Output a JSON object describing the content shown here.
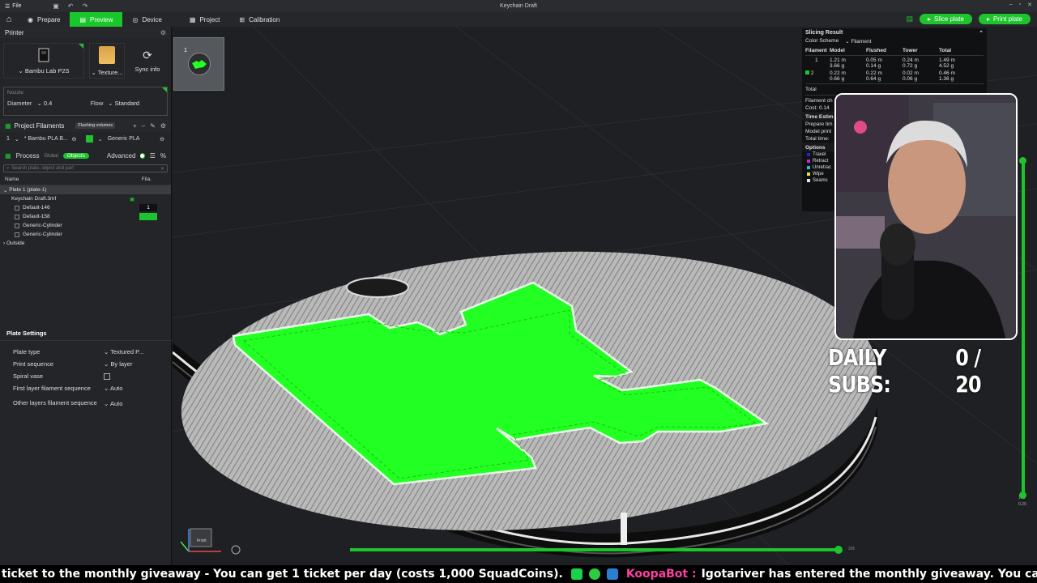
{
  "titlebar": {
    "file_label": "File",
    "doc_title": "Keychain Draft"
  },
  "nav": {
    "tabs": [
      {
        "label": "Prepare",
        "icon": "prepare-icon"
      },
      {
        "label": "Preview",
        "icon": "preview-icon",
        "active": true
      },
      {
        "label": "Device",
        "icon": "device-icon"
      },
      {
        "label": "Project",
        "icon": "project-icon"
      },
      {
        "label": "Calibration",
        "icon": "calibration-icon"
      }
    ],
    "slice_label": "Slice plate",
    "print_label": "Print plate"
  },
  "printer": {
    "section_title": "Printer",
    "printer_name": "Bambu Lab P2S",
    "plate_label": "Texture...",
    "sync_label": "Sync info",
    "nozzle_label": "Nozzle",
    "diameter_label": "Diameter",
    "diameter_value": "0.4",
    "flow_label": "Flow",
    "flow_value": "Standard"
  },
  "filaments": {
    "section_title": "Project Filaments",
    "flushing_label": "Flushing volumes",
    "row_index": "1",
    "row_name": "* Bambu PLA B...",
    "row_type": "Generic PLA"
  },
  "process": {
    "section_title": "Process",
    "global_label": "Global",
    "objects_label": "Objects",
    "advanced_label": "Advanced",
    "search_placeholder": "Search plate, object and part",
    "col_name": "Name",
    "col_fila": "Fila.",
    "tree": [
      {
        "label": "Plate 1 (plate-1)",
        "indent": 0,
        "selected": true
      },
      {
        "label": "Keychain Draft.3mf",
        "indent": 1,
        "fila": "check"
      },
      {
        "label": "Default-146",
        "indent": 2,
        "fila": "1"
      },
      {
        "label": "Default-158",
        "indent": 2,
        "fila": "swatch"
      },
      {
        "label": "Generic-Cylinder",
        "indent": 2
      },
      {
        "label": "Generic-Cylinder",
        "indent": 2
      },
      {
        "label": "Outside",
        "indent": 0
      }
    ]
  },
  "plate_settings": {
    "title": "Plate Settings",
    "rows": [
      {
        "label": "Plate type",
        "value": "Textured P..."
      },
      {
        "label": "Print sequence",
        "value": "By layer"
      },
      {
        "label": "Spiral vase",
        "value": ""
      },
      {
        "label": "First layer filament sequence",
        "value": "Auto"
      },
      {
        "label": "Other layers filament sequence",
        "value": "Auto"
      }
    ]
  },
  "plate_tab": {
    "number": "1"
  },
  "result": {
    "title": "Slicing Result",
    "color_scheme_label": "Color Scheme",
    "color_scheme_value": "Filament",
    "headers": [
      "Filament",
      "Model",
      "Flushed",
      "Tower",
      "Total"
    ],
    "rows": [
      {
        "id": "1",
        "model": "1.21 m",
        "model2": "3.66 g",
        "flushed": "0.05 m",
        "flushed2": "0.14 g",
        "tower": "0.24 m",
        "tower2": "0.72 g",
        "total": "1.49 m",
        "total2": "4.52 g"
      },
      {
        "id": "2",
        "model": "0.22 m",
        "model2": "0.66 g",
        "flushed": "0.22 m",
        "flushed2": "0.64 g",
        "tower": "0.02 m",
        "tower2": "0.06 g",
        "total": "0.46 m",
        "total2": "1.36 g"
      }
    ],
    "total_label": "Total",
    "filament_change_label": "Filament ch",
    "cost_label": "Cost:",
    "cost_value": "0.14",
    "time_label": "Time Estim",
    "prepare_time_label": "Prepare tim",
    "model_print_label": "Model print",
    "total_time_label": "Total time:",
    "options_label": "Options",
    "options": [
      {
        "label": "Travel",
        "color": "#1a2bd6"
      },
      {
        "label": "Retract",
        "color": "#c42bd6"
      },
      {
        "label": "Unretrac",
        "color": "#2bb8d6"
      },
      {
        "label": "Wipe",
        "color": "#e8e23a"
      },
      {
        "label": "Seams",
        "color": "#e6e6e6"
      }
    ]
  },
  "overlay": {
    "subs_label": "DAILY SUBS:",
    "subs_value": "0 / 20"
  },
  "viewport": {
    "gizmo_label": "Front",
    "layer_bottom": "1",
    "layer_top": "0.20",
    "hslider_value": "295"
  },
  "ticker": {
    "msg1": "ticket to the monthly giveaway - You can get 1 ticket per day (costs 1,000 SquadCoins).",
    "bot_name": "KoopaBot :",
    "msg2": "Igotariver has entered the monthly giveaway. You can enter again in 16hours."
  },
  "colors": {
    "accent": "#1ec42e",
    "model_green": "#22ff22"
  }
}
